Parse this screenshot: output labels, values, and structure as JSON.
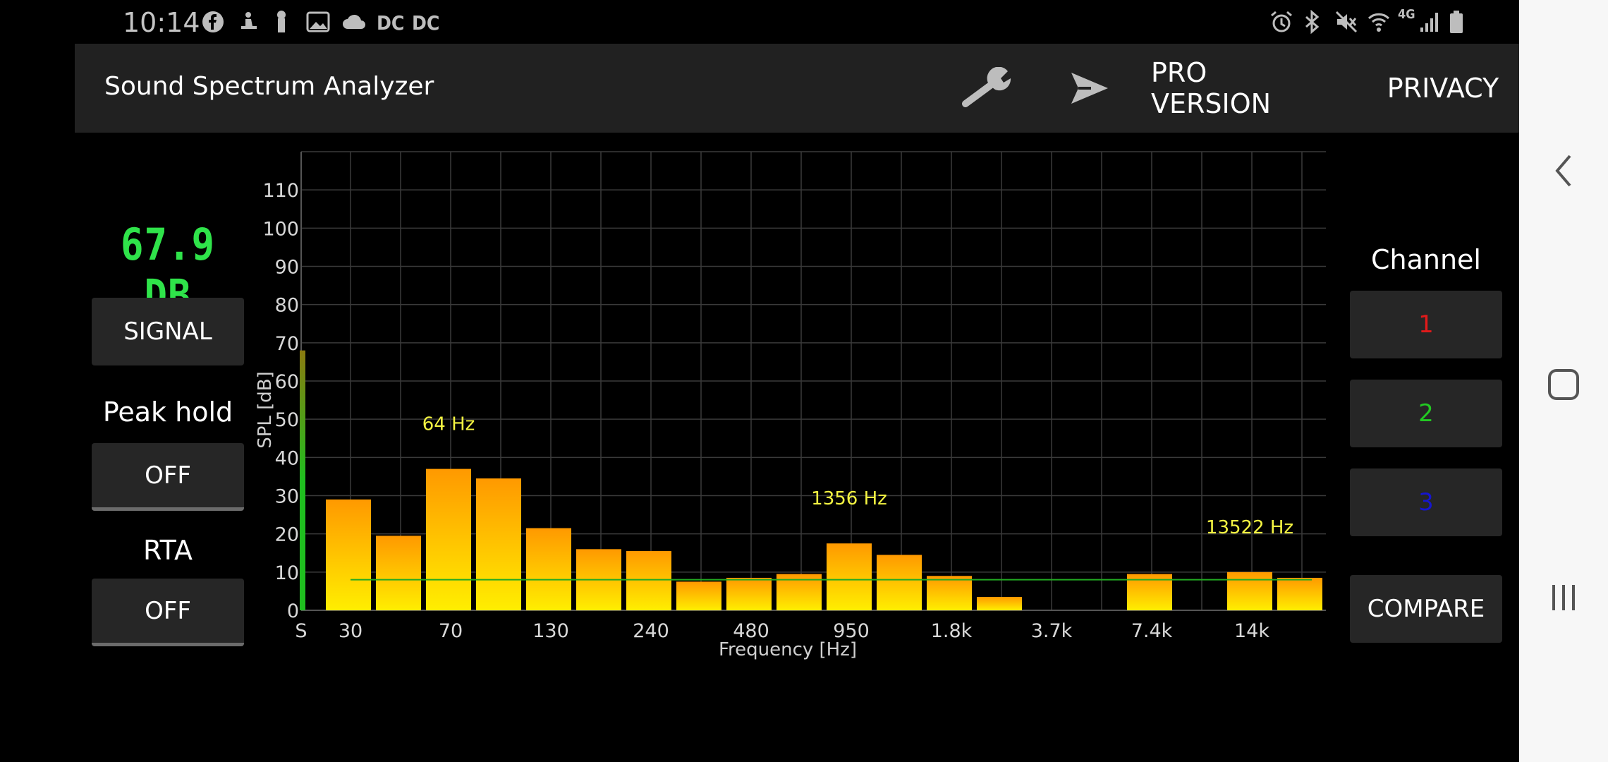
{
  "status_bar": {
    "time": "10:14",
    "left_icons": [
      "facebook-icon",
      "notification-icon",
      "notification-icon",
      "image-icon",
      "cloud-icon"
    ],
    "dc_labels": [
      "DC",
      "DC"
    ],
    "network_label": "4G",
    "right_icons": [
      "alarm-icon",
      "bluetooth-icon",
      "mute-icon",
      "wifi-icon",
      "signal-icon",
      "battery-icon"
    ]
  },
  "app_bar": {
    "title": "Sound Spectrum Analyzer",
    "settings_icon": "wrench-icon",
    "share_icon": "send-icon",
    "pro_label": "PRO VERSION",
    "privacy_label": "PRIVACY"
  },
  "left_panel": {
    "db_value": "67.9 DB",
    "signal_label": "SIGNAL",
    "peak_hold_label": "Peak hold",
    "peak_hold_value": "OFF",
    "rta_label": "RTA",
    "rta_value": "OFF"
  },
  "right_panel": {
    "channel_title": "Channel",
    "channels": [
      {
        "label": "1",
        "color": "#e11a1a"
      },
      {
        "label": "2",
        "color": "#22c922"
      },
      {
        "label": "3",
        "color": "#1515d0"
      }
    ],
    "compare_label": "COMPARE"
  },
  "chart_data": {
    "type": "bar",
    "xlabel": "Frequency [Hz]",
    "ylabel": "SPL [dB]",
    "ylim": [
      0,
      120
    ],
    "y_ticks": [
      "0",
      "10",
      "20",
      "30",
      "40",
      "50",
      "60",
      "70",
      "80",
      "90",
      "100",
      "110"
    ],
    "x_tick_labels": [
      "S",
      "30",
      "70",
      "130",
      "240",
      "480",
      "950",
      "1.8k",
      "3.7k",
      "7.4k",
      "14k"
    ],
    "signal_level": 68,
    "threshold": 8,
    "bars": [
      29,
      19.5,
      37,
      34.5,
      21.5,
      16,
      15.5,
      7.5,
      8.5,
      9.5,
      17.5,
      14.5,
      9,
      3.5,
      0,
      0,
      9.5,
      0,
      10,
      8.5
    ],
    "peaks": [
      {
        "label": "64 Hz"
      },
      {
        "label": "1356 Hz"
      },
      {
        "label": "13522 Hz"
      }
    ],
    "grid": true,
    "colors": {
      "bar_top_high": "#ff9900",
      "bar_bottom": "#ffee00",
      "signal": "#1fbf1f",
      "threshold": "#22aa22",
      "grid": "#3a3a3a"
    }
  }
}
